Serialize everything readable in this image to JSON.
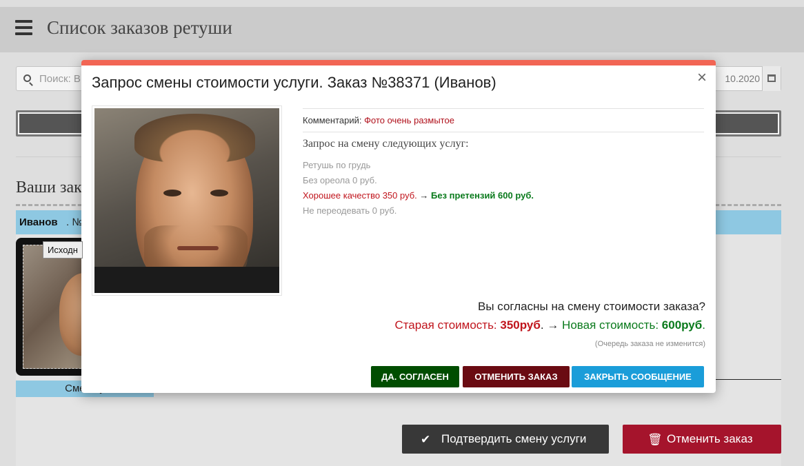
{
  "header": {
    "title": "Список заказов ретуши",
    "menu_icon": "hamburger-icon"
  },
  "search": {
    "placeholder": "Поиск: В",
    "date_value": "10.2020",
    "calendar_icon": "calendar-icon"
  },
  "section": {
    "title": "Ваши зак"
  },
  "order": {
    "customer_name": "Иванов",
    "number_prefix": ". №"
  },
  "thumbnail": {
    "label": "Исходн"
  },
  "service_change_label": "Смена у",
  "bottom_buttons": {
    "confirm_label": "Подтвердить смену услуги",
    "confirm_icon": "check-icon",
    "cancel_label": "Отменить заказ",
    "cancel_icon": "trash-icon"
  },
  "modal": {
    "title": "Запрос смены стоимости услуги. Заказ №38371 (Иванов)",
    "close_glyph": "×",
    "comment_label": "Комментарий:",
    "comment_value": "Фото очень размытое",
    "services_title": "Запрос на смену следующих услуг:",
    "services": [
      {
        "text": "Ретушь по грудь"
      },
      {
        "text": "Без ореола 0 руб."
      },
      {
        "old": "Хорошее качество 350 руб.",
        "arrow": " → ",
        "new": "Без претензий 600 руб."
      },
      {
        "text": "Не переодевать 0 руб."
      }
    ],
    "question": "Вы согласны на смену стоимости заказа?",
    "old_price_label": "Старая стоимость: ",
    "old_price_value": "350руб",
    "arrow_sep": ". → ",
    "new_price_label": "Новая стоимость: ",
    "new_price_value": "600руб",
    "end_dot": ".",
    "queue_note": "(Очередь заказа не изменится)",
    "buttons": {
      "agree": "ДА. СОГЛАСЕН",
      "cancel_order": "ОТМЕНИТЬ ЗАКАЗ",
      "close_message": "ЗАКРЫТЬ СООБЩЕНИЕ"
    }
  },
  "colors": {
    "modal_accent": "#f26554",
    "agree_button": "#004d00",
    "cancel_button": "#6a0b12",
    "close_button": "#1a9dd9",
    "old_price": "#c0141c",
    "new_price": "#0a7a1c",
    "order_bar": "#8ec8e2",
    "bottom_cancel": "#a5142c",
    "bottom_confirm": "#383838"
  }
}
